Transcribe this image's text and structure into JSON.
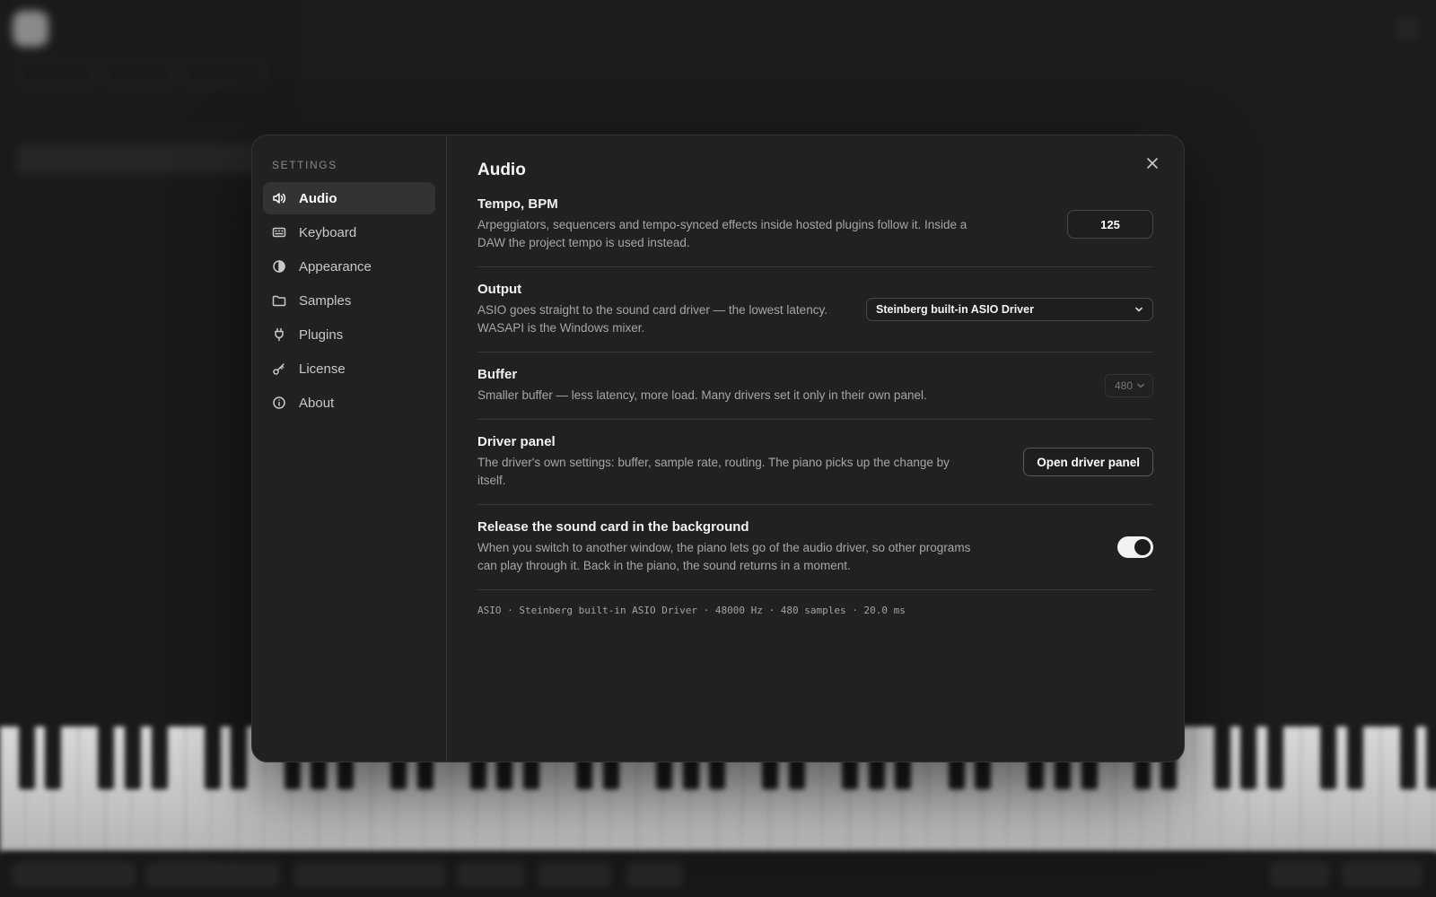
{
  "settings": {
    "heading": "SETTINGS",
    "nav": [
      {
        "label": "Audio",
        "icon": "speaker-icon",
        "active": true
      },
      {
        "label": "Keyboard",
        "icon": "keyboard-icon",
        "active": false
      },
      {
        "label": "Appearance",
        "icon": "contrast-icon",
        "active": false
      },
      {
        "label": "Samples",
        "icon": "folder-icon",
        "active": false
      },
      {
        "label": "Plugins",
        "icon": "plug-icon",
        "active": false
      },
      {
        "label": "License",
        "icon": "key-icon",
        "active": false
      },
      {
        "label": "About",
        "icon": "info-icon",
        "active": false
      }
    ]
  },
  "audio": {
    "title": "Audio",
    "tempo": {
      "title": "Tempo, BPM",
      "desc": "Arpeggiators, sequencers and tempo-synced effects inside hosted plugins follow it. Inside a DAW the project tempo is used instead.",
      "value": "125"
    },
    "output": {
      "title": "Output",
      "desc": "ASIO goes straight to the sound card driver — the lowest latency. WASAPI is the Windows mixer.",
      "selected": "Steinberg built-in ASIO Driver"
    },
    "buffer": {
      "title": "Buffer",
      "desc": "Smaller buffer — less latency, more load. Many drivers set it only in their own panel.",
      "selected": "480"
    },
    "driver_panel": {
      "title": "Driver panel",
      "desc": "The driver's own settings: buffer, sample rate, routing. The piano picks up the change by itself.",
      "button_label": "Open driver panel"
    },
    "release": {
      "title": "Release the sound card in the background",
      "desc": "When you switch to another window, the piano lets go of the audio driver, so other programs can play through it. Back in the piano, the sound returns in a moment.",
      "enabled": true
    },
    "status": "ASIO · Steinberg built-in ASIO Driver · 48000 Hz · 480 samples · 20.0 ms"
  },
  "colors": {
    "background": "#1c1c1d",
    "modal": "#212122",
    "active_nav": "#333335",
    "toggle_on": "#f2f2f2"
  }
}
